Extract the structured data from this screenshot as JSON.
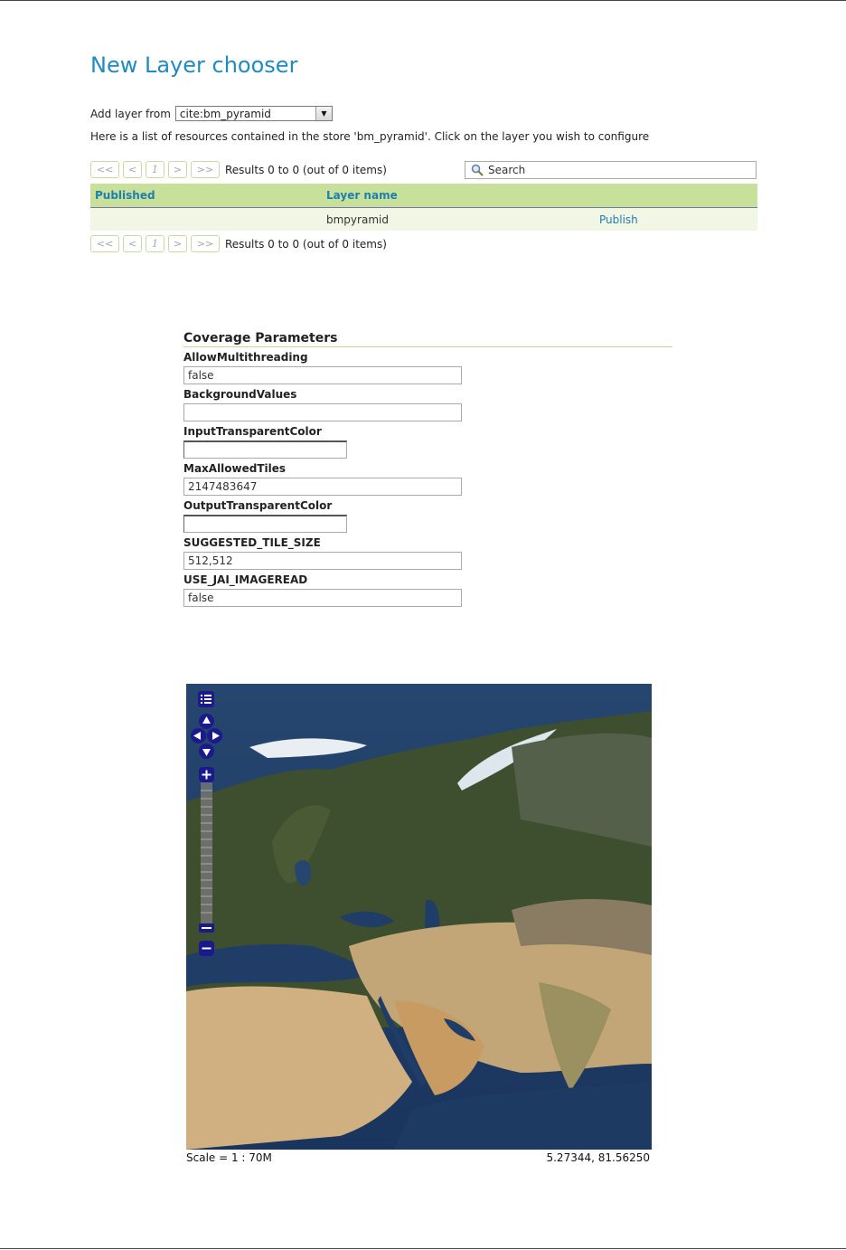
{
  "title": "New Layer chooser",
  "add_layer": {
    "label": "Add layer from",
    "selected_store": "cite:bm_pyramid"
  },
  "description": "Here is a list of resources contained in the store 'bm_pyramid'. Click on the layer you wish to configure",
  "pager": {
    "first": "<<",
    "prev": "<",
    "page": "1",
    "next": ">",
    "last": ">>",
    "results": "Results 0 to 0 (out of 0 items)"
  },
  "search": {
    "placeholder": "Search",
    "icon": "magnifier-icon"
  },
  "table": {
    "headers": [
      "Published",
      "Layer name",
      ""
    ],
    "rows": [
      {
        "published": "",
        "layer_name": "bmpyramid",
        "action": "Publish"
      }
    ]
  },
  "coverage": {
    "heading": "Coverage Parameters",
    "params": [
      {
        "label": "AllowMultithreading",
        "value": "false"
      },
      {
        "label": "BackgroundValues",
        "value": ""
      },
      {
        "label": "InputTransparentColor",
        "value": ""
      },
      {
        "label": "MaxAllowedTiles",
        "value": "2147483647"
      },
      {
        "label": "OutputTransparentColor",
        "value": ""
      },
      {
        "label": "SUGGESTED_TILE_SIZE",
        "value": "512,512"
      },
      {
        "label": "USE_JAI_IMAGEREAD",
        "value": "false"
      }
    ]
  },
  "map": {
    "scale": "Scale = 1 : 70M",
    "coordinates": "5.27344, 81.56250",
    "controls": [
      "layer-switcher-icon",
      "pan-up-icon",
      "pan-left-icon",
      "pan-right-icon",
      "pan-down-icon",
      "zoom-in-icon",
      "zoom-out-icon"
    ]
  },
  "colors": {
    "accent": "#1e8bc3",
    "table_header_bg": "#c8e19a",
    "row_bg": "#f1f6e5",
    "map_ocean": "#1d3a63",
    "map_control": "#1a1a8c"
  }
}
